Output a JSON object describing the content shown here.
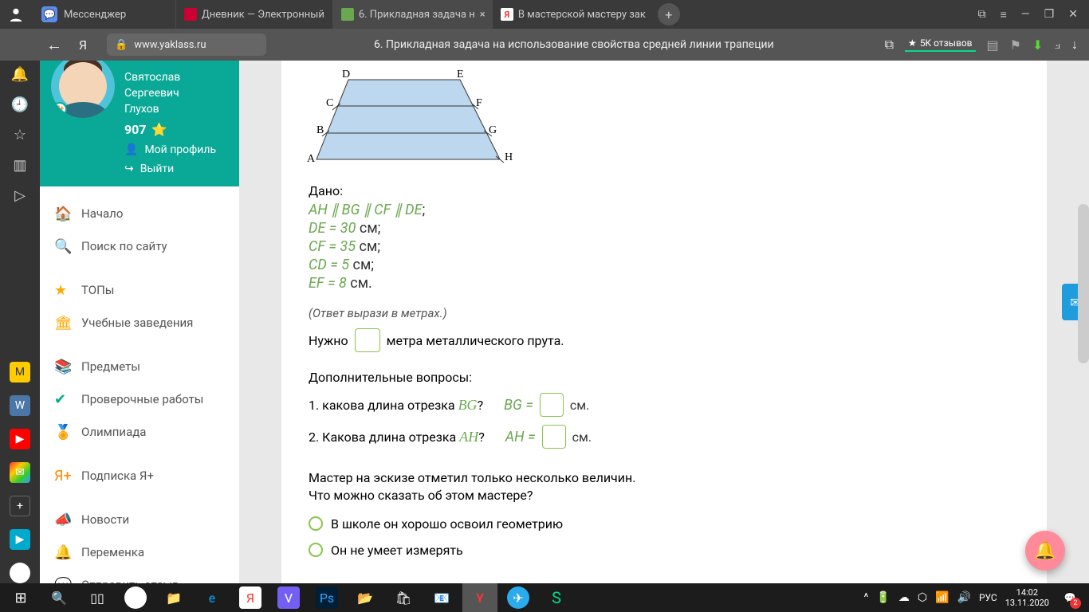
{
  "titlebar": {
    "messenger": "Мессенджер",
    "tabs": [
      {
        "label": "Дневник — Электронный"
      },
      {
        "label": "6. Прикладная задача н"
      },
      {
        "label": "В мастерской мастеру зак"
      }
    ]
  },
  "addressbar": {
    "url": "www.yaklass.ru",
    "title": "6. Прикладная задача на использование свойства средней линии трапеции",
    "reviews": "5K отзывов"
  },
  "profile": {
    "name_l1": "Святослав",
    "name_l2": "Сергеевич",
    "name_l3": "Глухов",
    "points": "907",
    "link_profile": "Мой профиль",
    "link_logout": "Выйти"
  },
  "nav": {
    "home": "Начало",
    "search": "Поиск по сайту",
    "tops": "ТОПы",
    "schools": "Учебные заведения",
    "subjects": "Предметы",
    "tests": "Проверочные работы",
    "olymp": "Олимпиада",
    "yaplus": "Подписка Я+",
    "news": "Новости",
    "break": "Переменка",
    "feedback": "Отправить отзыв"
  },
  "problem": {
    "given": "Дано:",
    "parallel_line": "AH ∥ BG ∥ CF ∥ DE",
    "de": "DE = 30",
    "cf": "CF = 35",
    "cd": "CD = 5",
    "ef": "EF = 8",
    "unit_cm": " см;",
    "unit_cm_dot": " см.",
    "note": "(Ответ вырази в метрах.)",
    "need_pre": "Нужно",
    "need_post": "метра металлического прута.",
    "subq_label": "Дополнительные вопросы:",
    "q1_text": "1. какова длина отрезка ",
    "q1_var": "BG",
    "q1_eq": "BG =",
    "q2_text": "2. Какова длина отрезка ",
    "q2_var": "AH",
    "q2_eq": "AH =",
    "cm": "см.",
    "essay1": "Мастер на эскизе отметил только несколько величин.",
    "essay2": "Что можно сказать об этом мастере?",
    "opt1": "В школе он хорошо освоил геометрию",
    "opt2": "Он не умеет измерять"
  },
  "diagram": {
    "A": "A",
    "B": "B",
    "C": "C",
    "D": "D",
    "E": "E",
    "F": "F",
    "G": "G",
    "H": "H"
  },
  "taskbar": {
    "lang": "РУС",
    "time": "14:02",
    "date": "13.11.2020",
    "notif_count": "2"
  }
}
